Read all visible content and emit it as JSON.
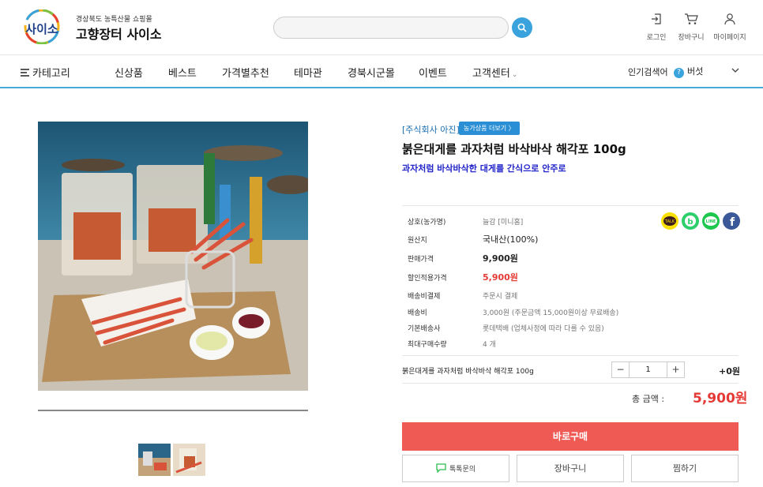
{
  "header": {
    "logo_mark": "사이소",
    "logo_sub": "경상북도 농특산물 쇼핑몰",
    "logo_title": "고향장터 사이소",
    "search_value": "",
    "util": [
      {
        "label": "로그인",
        "icon": "login-icon"
      },
      {
        "label": "장바구니",
        "icon": "cart-icon"
      },
      {
        "label": "마이페이지",
        "icon": "user-icon"
      }
    ]
  },
  "nav": {
    "category": "카테고리",
    "items": [
      "신상품",
      "베스트",
      "가격별추천",
      "테마관",
      "경북시군몰",
      "이벤트",
      "고객센터"
    ],
    "popular_label": "인기검색어",
    "popular_badge": "?",
    "popular_keyword": "버섯"
  },
  "product": {
    "brand": "[주식회사 아진]",
    "more_button": "농가상품 더보기 〉",
    "title": "붉은대게를 과자처럼 바삭바삭 해각포 100g",
    "subtitle": "과자처럼 바삭바삭한 대게를 간식으로 안주로",
    "info": [
      {
        "label": "상호(농가명)",
        "value": "늘감 [미니홈]"
      },
      {
        "label": "원산지",
        "value": "국내산(100%)"
      },
      {
        "label": "판매가격",
        "value": "9,900원"
      },
      {
        "label": "할인적용가격",
        "value": "5,900원"
      },
      {
        "label": "배송비결제",
        "value": "주문시 결제"
      },
      {
        "label": "배송비",
        "value": "3,000원 (주문금액 15,000원이상 무료배송)"
      },
      {
        "label": "기본배송사",
        "value": "롯데택배 (업체사정에 따라 다를 수 있음)"
      },
      {
        "label": "최대구매수량",
        "value": "4 개"
      }
    ],
    "share": [
      {
        "name": "kakaotalk",
        "text": "TALK",
        "color": "#f9e000"
      },
      {
        "name": "band",
        "text": "b",
        "color": "#2dcf6a"
      },
      {
        "name": "line",
        "text": "LINE",
        "color": "#1ec84e"
      },
      {
        "name": "facebook",
        "text": "f",
        "color": "#3b5998"
      }
    ],
    "option_name": "붉은대게를 과자처럼 바삭바삭 해각포 100g",
    "qty_minus": "−",
    "qty_value": "1",
    "qty_plus": "+",
    "option_price": "+0원",
    "total_label": "총 금액 :",
    "total_value": "5,900원",
    "buy_button": "바로구매",
    "talk_button": "톡톡문의",
    "cart_button": "장바구니",
    "wish_button": "찜하기"
  },
  "colors": {
    "accent": "#3aa2dc",
    "buy": "#f05a55",
    "price_red": "#e53935",
    "subtitle": "#2326c9"
  }
}
